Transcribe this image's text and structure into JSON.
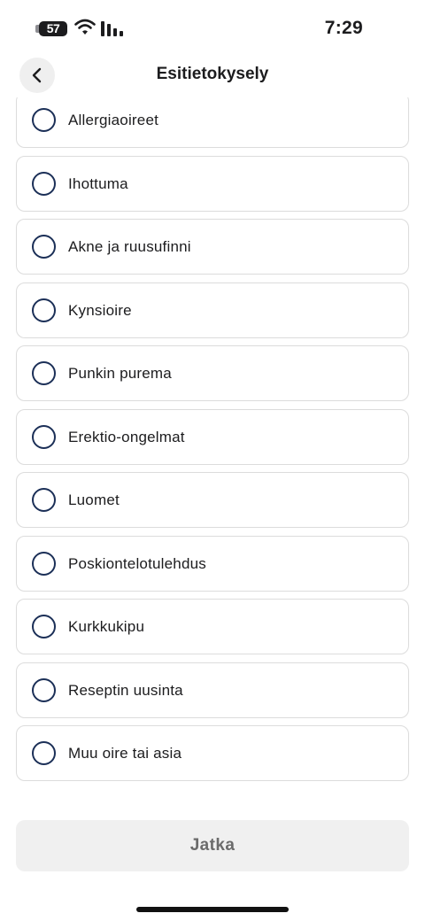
{
  "status_bar": {
    "battery_level": "57",
    "time": "7:29"
  },
  "header": {
    "title": "Esitietokysely",
    "back_icon": "chevron-left-icon"
  },
  "options": [
    {
      "label": "Allergiaoireet",
      "selected": false
    },
    {
      "label": "Ihottuma",
      "selected": false
    },
    {
      "label": "Akne ja ruusufinni",
      "selected": false
    },
    {
      "label": "Kynsioire",
      "selected": false
    },
    {
      "label": "Punkin purema",
      "selected": false
    },
    {
      "label": "Erektio-ongelmat",
      "selected": false
    },
    {
      "label": "Luomet",
      "selected": false
    },
    {
      "label": "Poskiontelotulehdus",
      "selected": false
    },
    {
      "label": "Kurkkukipu",
      "selected": false
    },
    {
      "label": "Reseptin uusinta",
      "selected": false
    },
    {
      "label": "Muu oire tai asia",
      "selected": false
    }
  ],
  "footer": {
    "continue_label": "Jatka"
  },
  "colors": {
    "radio_border": "#1b2f57",
    "option_border": "#dcdcdc",
    "button_bg": "#f0f0f0",
    "button_text": "#6b6b6b"
  }
}
